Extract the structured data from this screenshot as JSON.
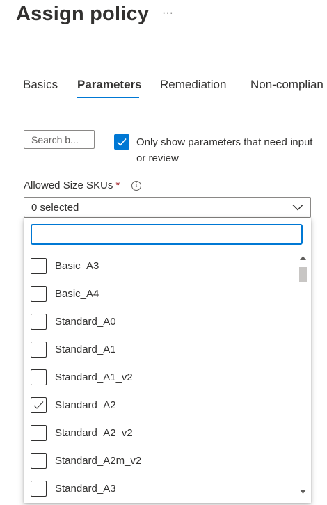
{
  "page": {
    "title": "Assign policy",
    "more_label": "···"
  },
  "tabs": [
    {
      "label": "Basics",
      "active": false
    },
    {
      "label": "Parameters",
      "active": true
    },
    {
      "label": "Remediation",
      "active": false
    },
    {
      "label": "Non-complian",
      "active": false
    }
  ],
  "filters": {
    "search_placeholder": "Search b...",
    "only_show_label": "Only show parameters that need input or review",
    "only_show_checked": true
  },
  "field": {
    "label": "Allowed Size SKUs",
    "required_mark": "*",
    "info_icon": "info-icon",
    "selected_text": "0 selected",
    "chevron_icon": "chevron-down-icon"
  },
  "dropdown": {
    "filter_value": "",
    "options": [
      {
        "label": "Basic_A3",
        "checked": false
      },
      {
        "label": "Basic_A4",
        "checked": false
      },
      {
        "label": "Standard_A0",
        "checked": false
      },
      {
        "label": "Standard_A1",
        "checked": false
      },
      {
        "label": "Standard_A1_v2",
        "checked": false
      },
      {
        "label": "Standard_A2",
        "checked": true
      },
      {
        "label": "Standard_A2_v2",
        "checked": false
      },
      {
        "label": "Standard_A2m_v2",
        "checked": false
      },
      {
        "label": "Standard_A3",
        "checked": false
      }
    ]
  },
  "colors": {
    "accent": "#0078d4",
    "text": "#323130",
    "required": "#a4262c"
  }
}
